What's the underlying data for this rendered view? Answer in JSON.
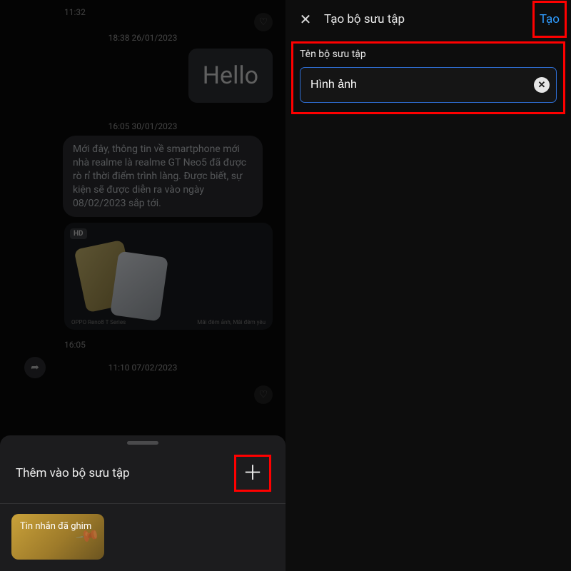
{
  "left": {
    "chat": {
      "time1": "11:32",
      "date1": "18:38 26/01/2023",
      "hello": "Hello",
      "date2": "16:05 30/01/2023",
      "news": "Mới đây, thông tin về smartphone mới nhà realme là realme GT Neo5 đã được rò rỉ thời điểm trình làng. Được biết, sự kiện sẽ được diễn ra vào ngày 08/02/2023 sắp tới.",
      "card_hd": "HD",
      "card_left": "OPPO Reno8 T Series",
      "card_right": "Mãi đêm ảnh, Mãi đêm yêu",
      "time3": "16:05",
      "date3": "11:10 07/02/2023"
    },
    "sheet": {
      "title": "Thêm vào bộ sưu tập",
      "tile": "Tin nhắn đã ghim"
    }
  },
  "right": {
    "title": "Tạo bộ sưu tập",
    "create": "Tạo",
    "label": "Tên bộ sưu tập",
    "value": "Hình ảnh"
  }
}
